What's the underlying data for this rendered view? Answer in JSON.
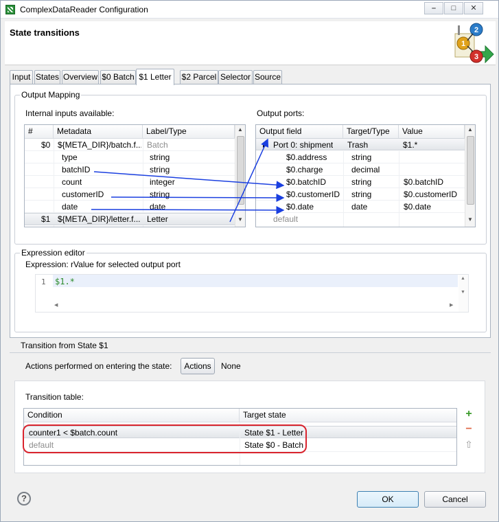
{
  "window": {
    "title": "ComplexDataReader Configuration",
    "controls": [
      "⎯",
      "□",
      "✕"
    ]
  },
  "header": {
    "title": "State transitions",
    "badges": [
      "1",
      "2",
      "3"
    ]
  },
  "tabs": [
    {
      "label": "Input"
    },
    {
      "label": "States"
    },
    {
      "label": "Overview"
    },
    {
      "label": "$0 Batch"
    },
    {
      "label": "$1 Letter",
      "active": true
    },
    {
      "label": "$2 Parcel"
    },
    {
      "label": "Selector"
    },
    {
      "label": "Source"
    }
  ],
  "output_mapping": {
    "group_label": "Output Mapping",
    "inputs_label": "Internal inputs available:",
    "ports_label": "Output ports:",
    "inputs_columns": [
      "#",
      "Metadata",
      "Label/Type"
    ],
    "inputs_rows": [
      {
        "num": "$0",
        "meta": "${META_DIR}/batch.f...",
        "label": "Batch"
      },
      {
        "num": "",
        "meta": "type",
        "label": "string"
      },
      {
        "num": "",
        "meta": "batchID",
        "label": "string"
      },
      {
        "num": "",
        "meta": "count",
        "label": "integer"
      },
      {
        "num": "",
        "meta": "customerID",
        "label": "string"
      },
      {
        "num": "",
        "meta": "date",
        "label": "date"
      },
      {
        "num": "$1",
        "meta": "${META_DIR}/letter.f...",
        "label": "Letter"
      }
    ],
    "ports_columns": [
      "Output field",
      "Target/Type",
      "Value"
    ],
    "ports_rows": [
      {
        "field": "Port 0: shipment",
        "type": "Trash",
        "value": "$1.*"
      },
      {
        "field": "$0.address",
        "type": "string",
        "value": ""
      },
      {
        "field": "$0.charge",
        "type": "decimal",
        "value": ""
      },
      {
        "field": "$0.batchID",
        "type": "string",
        "value": "$0.batchID"
      },
      {
        "field": "$0.customerID",
        "type": "string",
        "value": "$0.customerID"
      },
      {
        "field": "$0.date",
        "type": "date",
        "value": "$0.date"
      },
      {
        "field": "default",
        "type": "",
        "value": ""
      }
    ]
  },
  "expression_editor": {
    "group_label": "Expression editor",
    "label": "Expression: rValue for selected output port",
    "line_number": "1",
    "code": "$1.*"
  },
  "transition": {
    "group_label": "Transition from State $1",
    "actions_label": "Actions performed on entering the state:",
    "actions_button": "Actions",
    "actions_value": "None",
    "table_label": "Transition table:",
    "columns": [
      "Condition",
      "Target state"
    ],
    "rows": [
      {
        "condition": "counter1 < $batch.count",
        "target": "State $1 - Letter"
      },
      {
        "condition": "default",
        "target": "State $0 - Batch"
      }
    ],
    "side_buttons": [
      "+",
      "−",
      "⇧"
    ]
  },
  "footer": {
    "help": "?",
    "ok": "OK",
    "cancel": "Cancel"
  },
  "colors": {
    "accent_blue": "#1a3fe0",
    "highlight_red": "#d9232d",
    "code_green": "#2a8a2a"
  }
}
